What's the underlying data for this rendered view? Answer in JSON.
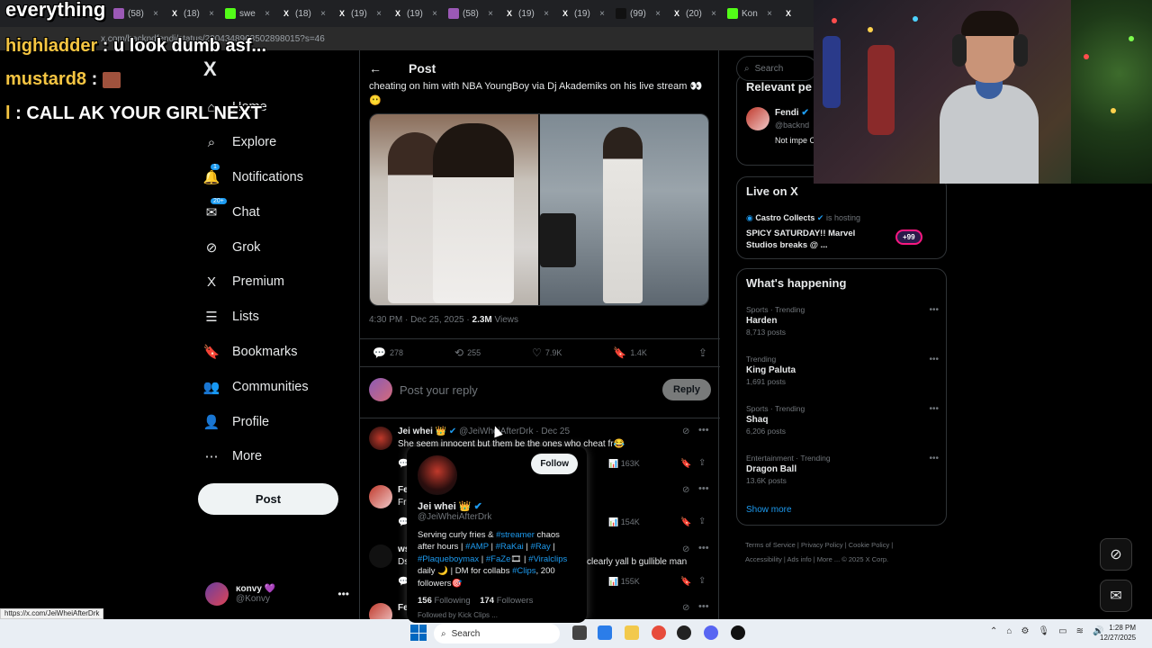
{
  "browser": {
    "tabs": [
      {
        "icon": "tab-purple-icon",
        "label": "(58)",
        "color": "#9b59b6"
      },
      {
        "icon": "x-logo-icon",
        "label": "(18)",
        "color": "#202124"
      },
      {
        "icon": "kick-icon",
        "label": "swe",
        "color": "#53fc18"
      },
      {
        "icon": "x-logo-icon",
        "label": "(18)",
        "color": "#202124"
      },
      {
        "icon": "x-logo-icon",
        "label": "(19)",
        "color": "#202124"
      },
      {
        "icon": "x-logo-icon",
        "label": "(19)",
        "color": "#202124"
      },
      {
        "icon": "tab-purple-icon",
        "label": "(58)",
        "color": "#9b59b6"
      },
      {
        "icon": "x-logo-icon",
        "label": "(19)",
        "color": "#202124"
      },
      {
        "icon": "x-logo-icon",
        "label": "(19)",
        "color": "#202124"
      },
      {
        "icon": "tiktok-icon",
        "label": "(99)",
        "color": "#111"
      },
      {
        "icon": "x-logo-icon",
        "label": "(20)",
        "color": "#202124"
      },
      {
        "icon": "kick-icon",
        "label": "Kon",
        "color": "#53fc18"
      },
      {
        "icon": "x-logo-icon",
        "label": "",
        "color": "#202124"
      }
    ],
    "url": "x.com/backndfendi/status/2004348963502898015?s=46",
    "status_url": "https://x.com/JeiWheiAfterDrk"
  },
  "overlay": {
    "title": "everything",
    "lines": [
      {
        "name": "highladder",
        "sep": " : ",
        "text": "u look dumb asf..."
      },
      {
        "name": "mustard8",
        "sep": " : ",
        "text": ""
      },
      {
        "name": "l",
        "sep": " : ",
        "text": "CALL AK YOUR GIRL NEXT"
      }
    ]
  },
  "nav": {
    "logo": "X",
    "items": [
      {
        "label": "Home",
        "icon": "home-icon",
        "glyph": "⌂"
      },
      {
        "label": "Explore",
        "icon": "search-icon",
        "glyph": "⌕"
      },
      {
        "label": "Notifications",
        "icon": "bell-icon",
        "glyph": "🔔",
        "badge": "1"
      },
      {
        "label": "Chat",
        "icon": "chat-icon",
        "glyph": "✉",
        "badge": "20+"
      },
      {
        "label": "Grok",
        "icon": "grok-icon",
        "glyph": "⊘"
      },
      {
        "label": "Premium",
        "icon": "x-premium-icon",
        "glyph": "X"
      },
      {
        "label": "Lists",
        "icon": "list-icon",
        "glyph": "☰"
      },
      {
        "label": "Bookmarks",
        "icon": "bookmark-icon",
        "glyph": "🔖"
      },
      {
        "label": "Communities",
        "icon": "communities-icon",
        "glyph": "👥"
      },
      {
        "label": "Profile",
        "icon": "profile-icon",
        "glyph": "👤"
      },
      {
        "label": "More",
        "icon": "more-circle-icon",
        "glyph": "⋯"
      }
    ],
    "post_button": "Post",
    "account": {
      "name": "ĸonvy 💜",
      "handle": "@Konvy"
    }
  },
  "post": {
    "header": "Post",
    "text": "cheating on him with NBA YoungBoy via Dj Akademiks on his live stream 👀😶",
    "time": "4:30 PM · Dec 25, 2025 · ",
    "views": "2.3M",
    "views_label": " Views",
    "stats": {
      "replies": "278",
      "reposts": "255",
      "likes": "7.9K",
      "bookmarks": "1.4K"
    },
    "reply_placeholder": "Post your reply",
    "reply_button": "Reply"
  },
  "replies": [
    {
      "name": "Jei whei 👑",
      "handle": "@JeiWheiAfterDrk · Dec 25",
      "text": "She seem innocent but them be the ones who cheat fr😂",
      "views": "163K"
    },
    {
      "name": "Fe",
      "handle": "",
      "text": "Fr",
      "views": "154K"
    },
    {
      "name": "ws",
      "handle": "",
      "text": "Ds",
      "text2": "clearly yall b gullible man",
      "views": "155K"
    },
    {
      "name": "Fe",
      "handle": "",
      "text": "",
      "views": ""
    }
  ],
  "hover_card": {
    "name": "Jei whei 👑",
    "handle": "@JeiWheiAfterDrk",
    "follow": "Follow",
    "bio_parts": [
      {
        "t": "Serving curly fries & ",
        "tag": false
      },
      {
        "t": "#streamer",
        "tag": true
      },
      {
        "t": " chaos after hours | ",
        "tag": false
      },
      {
        "t": "#AMP",
        "tag": true
      },
      {
        "t": " | ",
        "tag": false
      },
      {
        "t": "#RaKai",
        "tag": true
      },
      {
        "t": " | ",
        "tag": false
      },
      {
        "t": "#Ray",
        "tag": true
      },
      {
        "t": " | ",
        "tag": false
      },
      {
        "t": "#Plaqueboymax",
        "tag": true
      },
      {
        "t": " | ",
        "tag": false
      },
      {
        "t": "#FaZe",
        "tag": true
      },
      {
        "t": "🎞 | ",
        "tag": false
      },
      {
        "t": "#Viralclips",
        "tag": true
      },
      {
        "t": " daily 🌙 | DM for collabs ",
        "tag": false
      },
      {
        "t": "#Clips",
        "tag": true
      },
      {
        "t": ", 200 followers🎯",
        "tag": false
      }
    ],
    "following": "156",
    "following_label": " Following",
    "followers": "174",
    "followers_label": " Followers",
    "followed_by": "Followed by Kick Clips ..."
  },
  "sidebar": {
    "search_placeholder": "Search",
    "relevant_title": "Relevant pe",
    "relevant": {
      "name": "Fendi",
      "handle": "@backnd",
      "desc": "Not impe Clipper &"
    },
    "live_title": "Live on X",
    "live": {
      "host": "Castro Collects",
      "hosting": " is hosting",
      "title": "SPICY SATURDAY!! Marvel Studios breaks @ ...",
      "badge": "+99"
    },
    "happening_title": "What's happening",
    "trends": [
      {
        "cat": "Sports · Trending",
        "name": "Harden",
        "posts": "8,713 posts"
      },
      {
        "cat": "Trending",
        "name": "King Paluta",
        "posts": "1,691 posts"
      },
      {
        "cat": "Sports · Trending",
        "name": "Shaq",
        "posts": "6,206 posts"
      },
      {
        "cat": "Entertainment · Trending",
        "name": "Dragon Ball",
        "posts": "13.6K posts"
      }
    ],
    "show_more": "Show more",
    "footer_1": "Terms of Service  |  Privacy Policy  |  Cookie Policy  |",
    "footer_2": "Accessibility  |  Ads info  |  More ...  © 2025 X Corp."
  },
  "taskbar": {
    "search": "Search",
    "time": "1:28 PM",
    "date": "12/27/2025"
  },
  "colors": {
    "accent": "#1d9bf0",
    "background": "#000000",
    "border": "#2f3336",
    "muted": "#71767b"
  }
}
